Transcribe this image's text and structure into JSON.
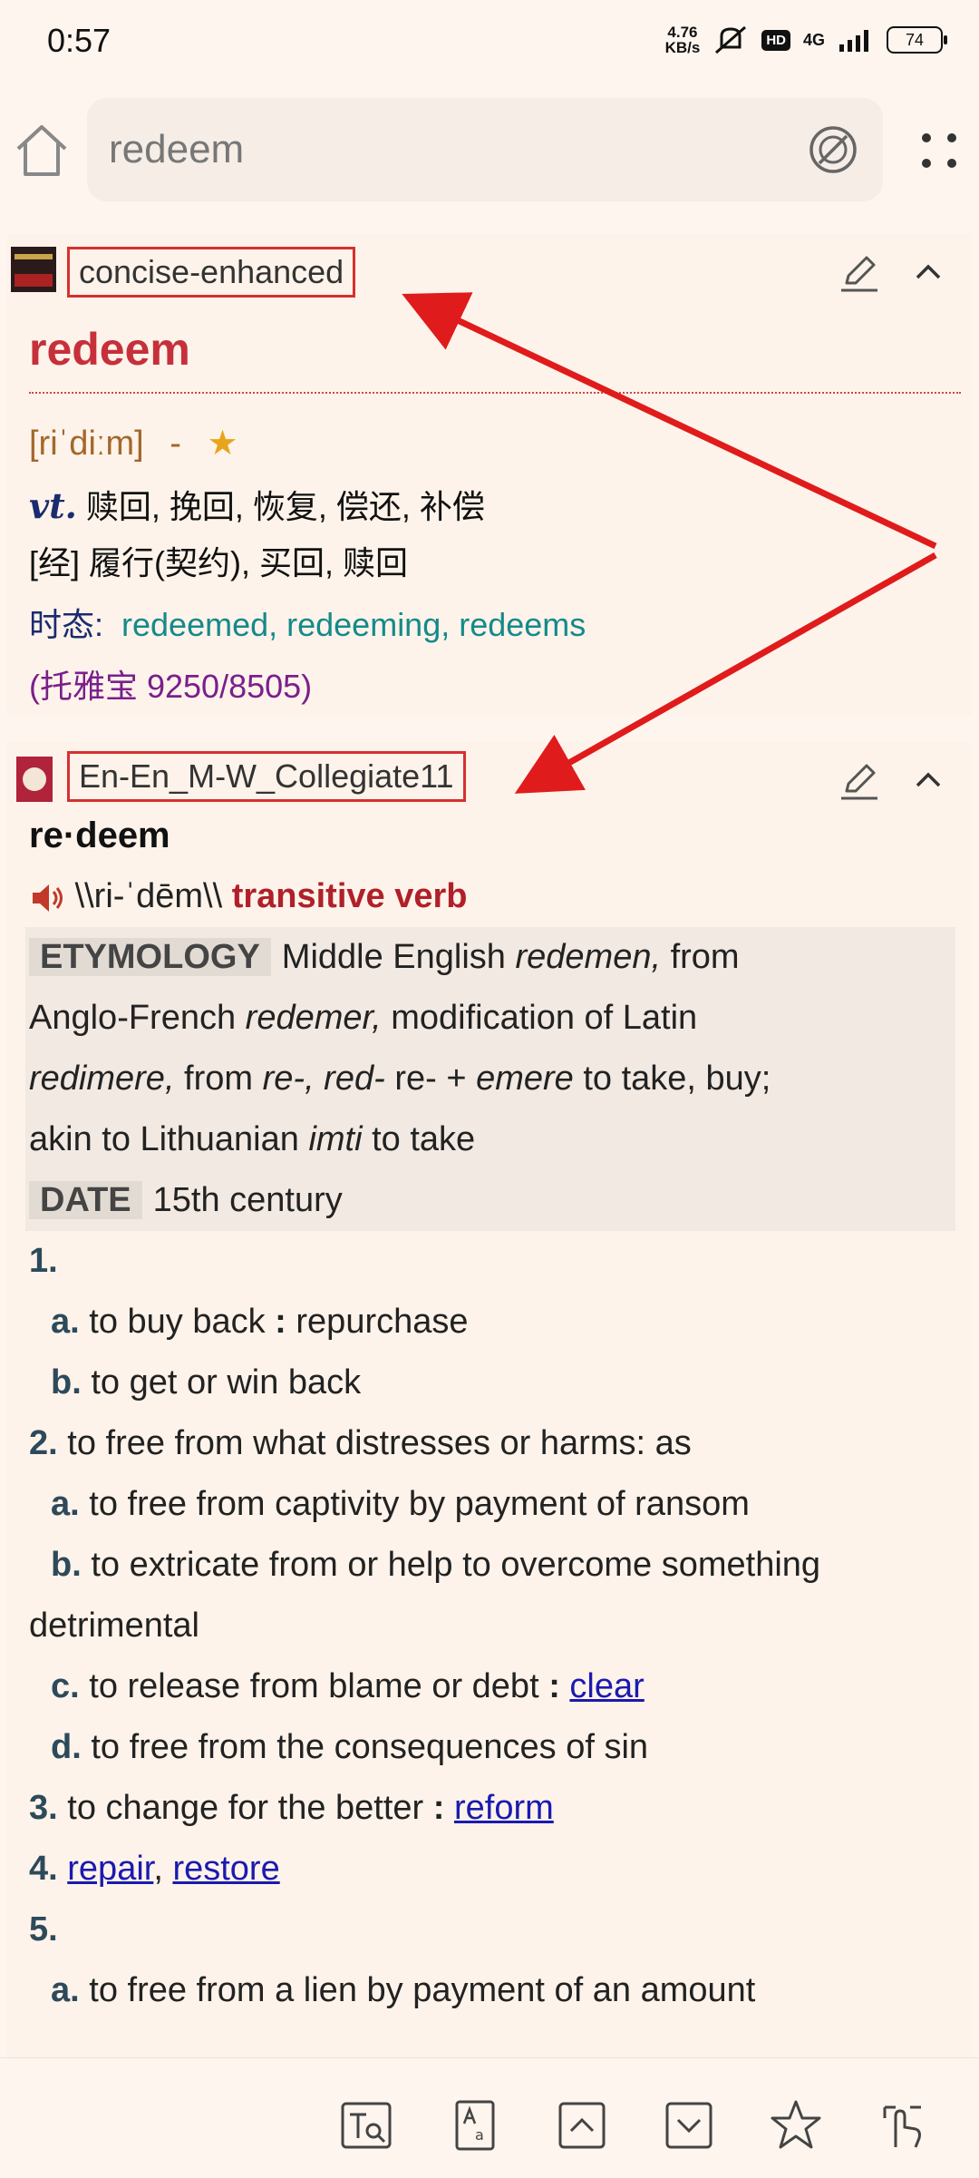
{
  "status": {
    "time": "0:57",
    "net_speed_value": "4.76",
    "net_speed_unit": "KB/s",
    "hd": "HD",
    "signal": "4G",
    "battery": "74"
  },
  "search": {
    "query": "redeem"
  },
  "card1": {
    "dict_name": "concise-enhanced",
    "headword": "redeem",
    "pron": "[riˈdiːm]",
    "pron_sep": "-",
    "star": "★",
    "pos": "vt.",
    "def1": "赎回, 挽回, 恢复, 偿还, 补偿",
    "def2": "[经] 履行(契约), 买回, 赎回",
    "tense_label": "时态:",
    "tense_value": "redeemed, redeeming, redeems",
    "exams": "(托雅宝 9250/8505)"
  },
  "card2": {
    "dict_name": "En-En_M-W_Collegiate11",
    "headword": "re·deem",
    "pron": "\\\\ri-ˈdēm\\\\",
    "pos": "transitive verb",
    "etymology_tag": "ETYMOLOGY",
    "etymology_text": [
      "Middle English ",
      "redemen,",
      " from",
      "Anglo-French ",
      "redemer,",
      " modification of Latin",
      "redimere,",
      " from ",
      "re-, red-",
      " re- + ",
      "emere",
      " to take, buy;",
      "akin to Lithuanian ",
      "imti",
      " to take"
    ],
    "date_tag": "DATE",
    "date_text": "15th century",
    "senses": {
      "n1": "1.",
      "n1a_letter": "a.",
      "n1a_text": "to buy back",
      "n1a_colon": ":",
      "n1a_syn": "repurchase",
      "n1b_letter": "b.",
      "n1b_text": "to get or win back",
      "n2": "2.",
      "n2_text": "to free from what distresses or harms: as",
      "n2a_letter": "a.",
      "n2a_text": "to free from captivity by payment of ransom",
      "n2b_letter": "b.",
      "n2b_text": "to extricate from or help to overcome something",
      "n2b_text2": "detrimental",
      "n2c_letter": "c.",
      "n2c_text": "to release from blame or debt",
      "n2c_colon": ":",
      "n2c_link": "clear",
      "n2d_letter": "d.",
      "n2d_text": "to free from the consequences of sin",
      "n3": "3.",
      "n3_text": "to change for the better",
      "n3_colon": ":",
      "n3_link": "reform",
      "n4": "4.",
      "n4_link1": "repair",
      "n4_comma": ",",
      "n4_link2": "restore",
      "n5": "5.",
      "n5a_letter": "a.",
      "n5a_text": "to free from a lien by payment of an amount"
    }
  },
  "colors": {
    "accent_red": "#c6303a",
    "link": "#1a1ab0",
    "tense": "#148a8a",
    "annotation": "#d63030"
  }
}
